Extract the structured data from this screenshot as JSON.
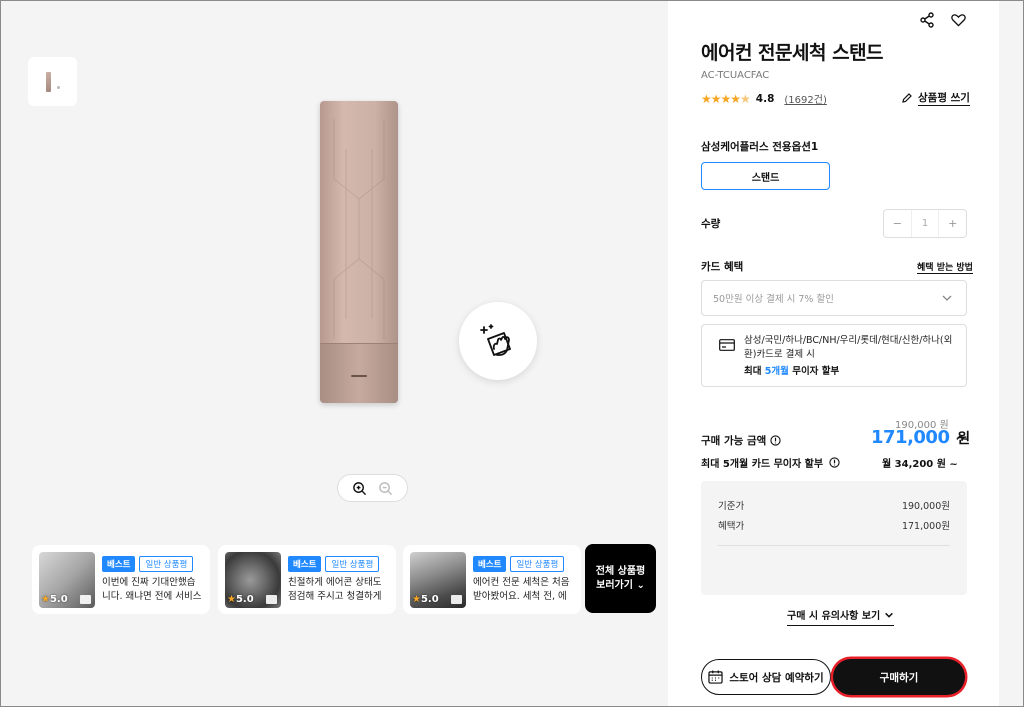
{
  "product": {
    "title": "에어컨 전문세척 스탠드",
    "model": "AC-TCUACFAC",
    "rating": "4.8",
    "review_count": "(1692건)",
    "write_review": "상품평 쓰기"
  },
  "option": {
    "label": "삼성케어플러스 전용옵션1",
    "selected": "스탠드"
  },
  "quantity": {
    "label": "수량",
    "minus": "−",
    "value": "1",
    "plus": "+"
  },
  "card": {
    "label": "카드 혜택",
    "how_link": "혜택 받는 방법",
    "select_placeholder": "50만원 이상 결제 시 7% 할인",
    "info_text": "삼성/국민/하나/BC/NH/우리/롯데/현대/신한/하나(외환)카드로 결제 시",
    "max_prefix": "최대 ",
    "max_highlight": "5개월",
    "max_suffix": " 무이자 할부"
  },
  "price": {
    "original": "190,000 원",
    "label": "구매 가능 금액",
    "amount": "171,000",
    "unit": "원",
    "installment_label": "최대 5개월 카드 무이자 할부",
    "installment_value": "월 34,200 원 ~",
    "breakdown": [
      {
        "name": "기준가",
        "value": "190,000원"
      },
      {
        "name": "혜택가",
        "value": "171,000원"
      }
    ]
  },
  "notice": "구매 시 유의사항 보기",
  "buttons": {
    "store": "스토어 상담 예약하기",
    "buy": "구매하기"
  },
  "reviews": [
    {
      "best": "베스트",
      "type": "일반 상품평",
      "rating": "5.0",
      "text": "이번에 진짜 기대안했습니다. 왜냐면 전에 서비스 받..."
    },
    {
      "best": "베스트",
      "type": "일반 상품평",
      "rating": "5.0",
      "text": "친절하게 에어콘 상태도 점검해 주시고 청결하게 사..."
    },
    {
      "best": "베스트",
      "type": "일반 상품평",
      "rating": "5.0",
      "text": "에어컨 전문 세척은 처음 받아봤어요. 세척 전, 에어컨 ..."
    }
  ],
  "all_reviews": {
    "line1": "전체 상품평",
    "line2": "보러가기"
  },
  "colors": {
    "accent": "#2189ff",
    "buy_outline": "#e8202a",
    "star": "#f5a623"
  }
}
